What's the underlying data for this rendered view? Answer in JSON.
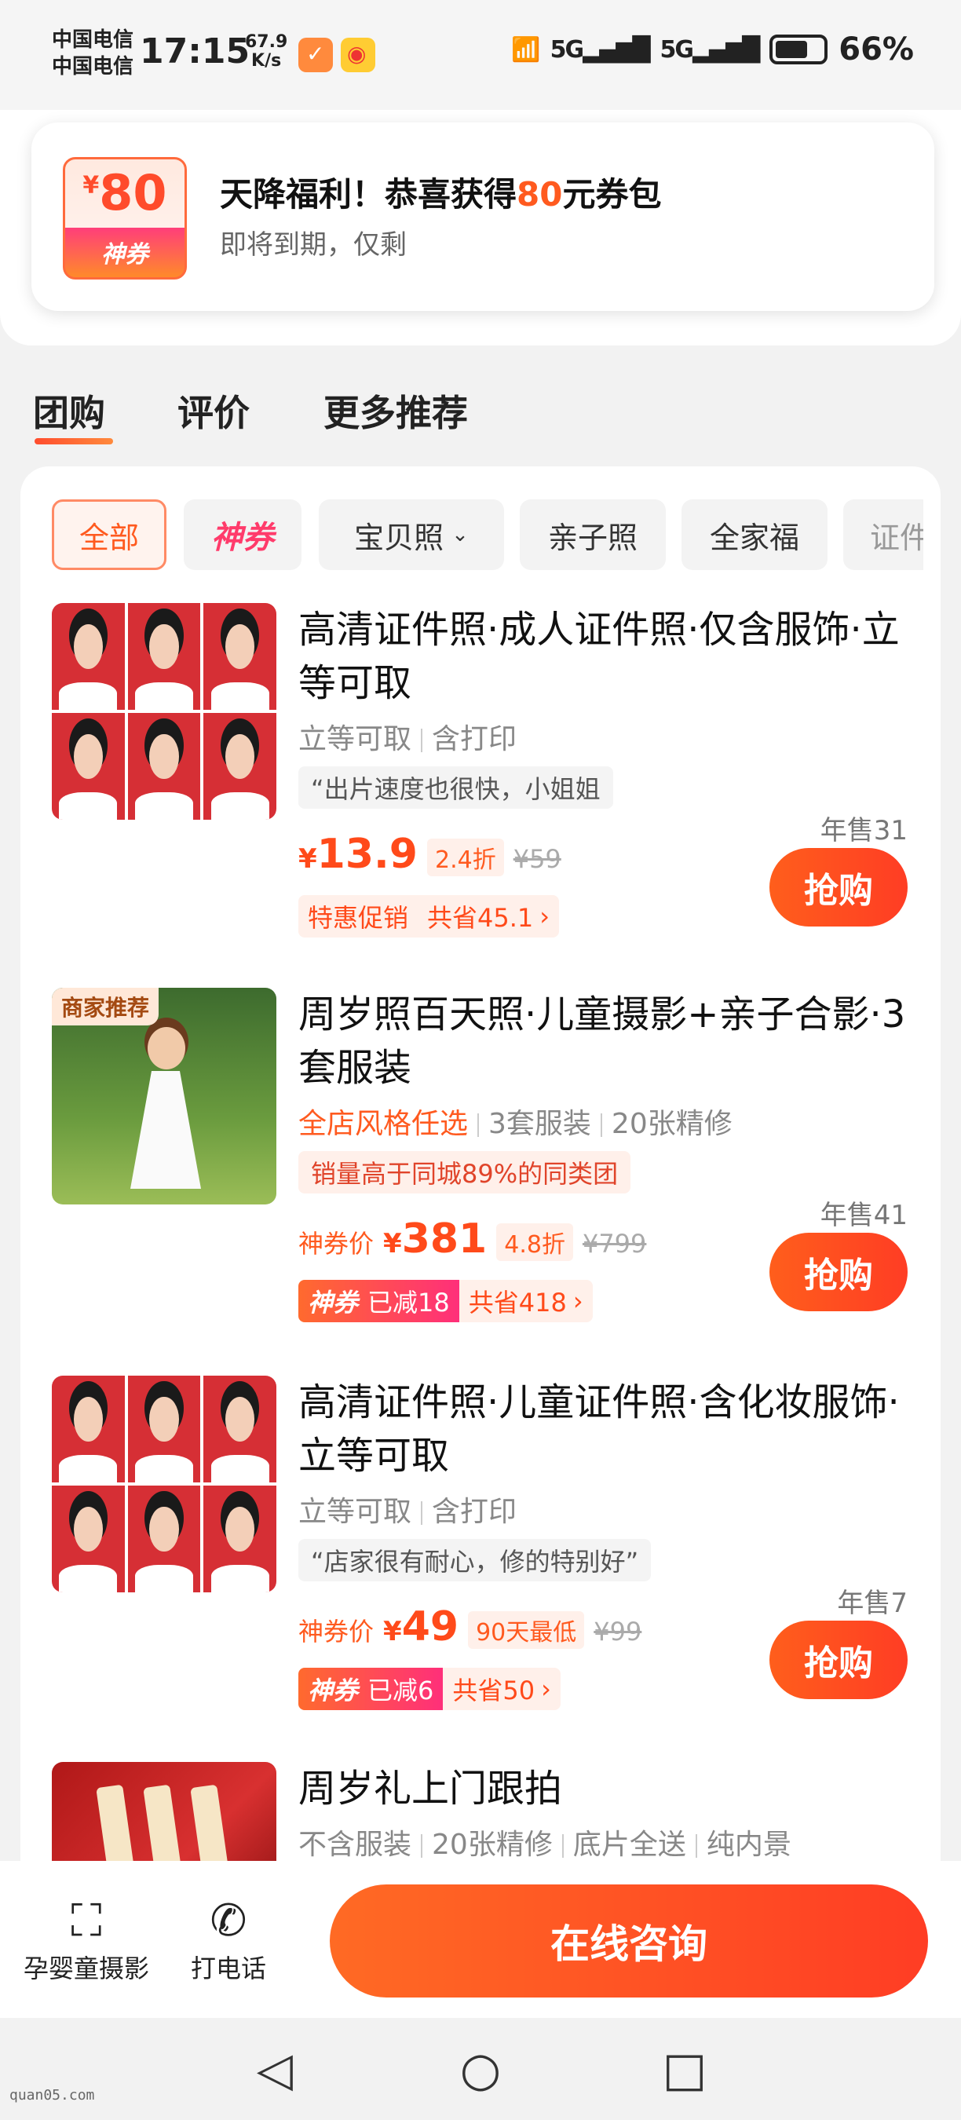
{
  "status_bar": {
    "carrier_1": "中国电信",
    "carrier_2": "中国电信",
    "time": "17:15",
    "speed_value": "67.9",
    "speed_unit": "K/s",
    "network_1": "5G",
    "network_2": "5G",
    "battery": "66%"
  },
  "coupon": {
    "amount_symbol": "¥",
    "amount": "80",
    "badge_label": "神券",
    "title_prefix": "天降福利！恭喜获得",
    "title_amount": "80",
    "title_suffix": "元券包",
    "subtitle": "即将到期，仅剩"
  },
  "tabs": [
    {
      "label": "团购",
      "active": true
    },
    {
      "label": "评价",
      "active": false
    },
    {
      "label": "更多推荐",
      "active": false
    }
  ],
  "filters": [
    {
      "label": "全部",
      "active": true
    },
    {
      "label": "神券",
      "active": false
    },
    {
      "label": "宝贝照",
      "active": false,
      "has_dropdown": true
    },
    {
      "label": "亲子照",
      "active": false
    },
    {
      "label": "全家福",
      "active": false
    },
    {
      "label": "证件",
      "active": false
    }
  ],
  "items": [
    {
      "title": "高清证件照·成人证件照·仅含服饰·立等可取",
      "tags": [
        "立等可取",
        "含打印"
      ],
      "quote": "“出片速度也很快，小姐姐",
      "price_label": "",
      "price_symbol": "¥",
      "price": "13.9",
      "discount": "2.4折",
      "original_price": "¥59",
      "promo_1": "特惠促销",
      "promo_2": "共省45.1",
      "sold": "年售31",
      "buy_label": "抢购"
    },
    {
      "badge": "商家推荐",
      "title": "周岁照百天照·儿童摄影+亲子合影·3套服装",
      "tag_highlight": "全店风格任选",
      "tags": [
        "3套服装",
        "20张精修"
      ],
      "quote": "销量高于同城89%的同类团",
      "price_label": "神券价",
      "price_symbol": "¥",
      "price": "381",
      "discount": "4.8折",
      "original_price": "¥799",
      "shen_label": "神券",
      "promo_reduced": "已减18",
      "promo_2": "共省418",
      "sold": "年售41",
      "buy_label": "抢购"
    },
    {
      "title": "高清证件照·儿童证件照·含化妆服饰·立等可取",
      "tags": [
        "立等可取",
        "含打印"
      ],
      "quote": "“店家很有耐心，修的特别好”",
      "price_label": "神券价",
      "price_symbol": "¥",
      "price": "49",
      "discount": "90天最低",
      "original_price": "¥99",
      "shen_label": "神券",
      "promo_reduced": "已减6",
      "promo_2": "共省50",
      "sold": "年售7",
      "buy_label": "抢购"
    },
    {
      "title": "周岁礼上门跟拍",
      "tags": [
        "不含服装",
        "20张精修",
        "底片全送",
        "纯内景"
      ]
    }
  ],
  "bottom_bar": {
    "item_1": "孕婴童摄影",
    "item_1_icon": "scan-face-icon",
    "item_2": "打电话",
    "item_2_icon": "phone-icon",
    "consult": "在线咨询"
  },
  "watermark": "quan05.com",
  "colors": {
    "accent": "#ff5a1f",
    "shen_gradient_end": "#ff2f7a"
  }
}
